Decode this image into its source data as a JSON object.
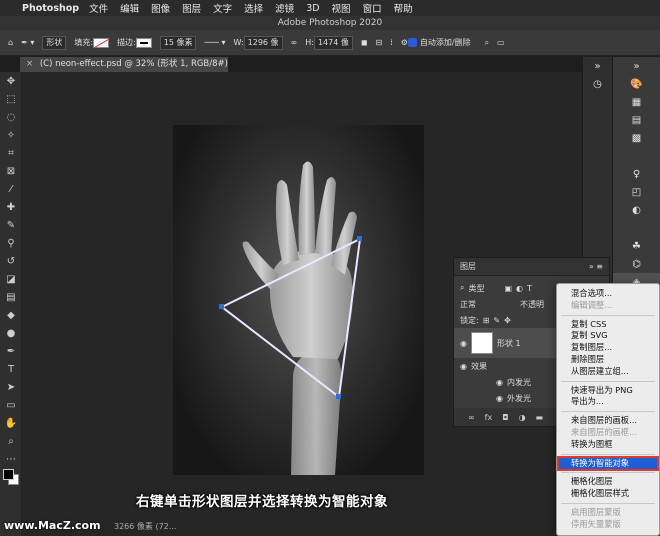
{
  "menubar": {
    "app": "Photoshop",
    "items": [
      "文件",
      "编辑",
      "图像",
      "图层",
      "文字",
      "选择",
      "滤镜",
      "3D",
      "视图",
      "窗口",
      "帮助"
    ]
  },
  "window": {
    "title": "Adobe Photoshop 2020"
  },
  "options": {
    "shape_mode": "形状",
    "fill_label": "填充:",
    "stroke_label": "描边:",
    "stroke_width": "15 像素",
    "w_label": "W:",
    "w_value": "1296 像",
    "h_label": "H:",
    "h_value": "1474 像",
    "auto_add_delete": "自动添加/删除"
  },
  "document": {
    "tab_title": "(C) neon-effect.psd @ 32% (形状 1, RGB/8#) *",
    "close": "×"
  },
  "layers_panel": {
    "title": "图层",
    "filter": "类型",
    "blend_mode": "正常",
    "opacity_label": "不透明",
    "lock_label": "锁定:",
    "layer_name": "形状 1",
    "effects_label": "效果",
    "effects": [
      "内发光",
      "外发光"
    ],
    "footer_icons": [
      "link-icon",
      "fx-icon",
      "mask-icon",
      "adjustment-icon",
      "folder-icon"
    ]
  },
  "context_menu": {
    "items": [
      {
        "label": "混合选项...",
        "disabled": false
      },
      {
        "label": "编辑调整...",
        "disabled": true
      },
      {
        "sep": true
      },
      {
        "label": "复制 CSS",
        "disabled": false
      },
      {
        "label": "复制 SVG",
        "disabled": false
      },
      {
        "label": "复制图层...",
        "disabled": false
      },
      {
        "label": "删除图层",
        "disabled": false
      },
      {
        "label": "从图层建立组...",
        "disabled": false
      },
      {
        "sep": true
      },
      {
        "label": "快速导出为 PNG",
        "disabled": false
      },
      {
        "label": "导出为...",
        "disabled": false
      },
      {
        "sep": true
      },
      {
        "label": "来自图层的画板...",
        "disabled": false
      },
      {
        "label": "来自图层的画框...",
        "disabled": true
      },
      {
        "label": "转换为图框",
        "disabled": false
      },
      {
        "sep": true
      },
      {
        "label": "转换为智能对象",
        "disabled": false,
        "highlighted": true
      },
      {
        "sep": true
      },
      {
        "label": "栅格化图层",
        "disabled": false
      },
      {
        "label": "栅格化图层样式",
        "disabled": false
      },
      {
        "sep": true
      },
      {
        "label": "启用图层蒙版",
        "disabled": true
      },
      {
        "label": "停用矢量蒙版",
        "disabled": true
      }
    ]
  },
  "caption": "右键单击形状图层并选择转换为智能对象",
  "watermark": "www.MacZ.com",
  "status": "3266 像素 (72..."
}
